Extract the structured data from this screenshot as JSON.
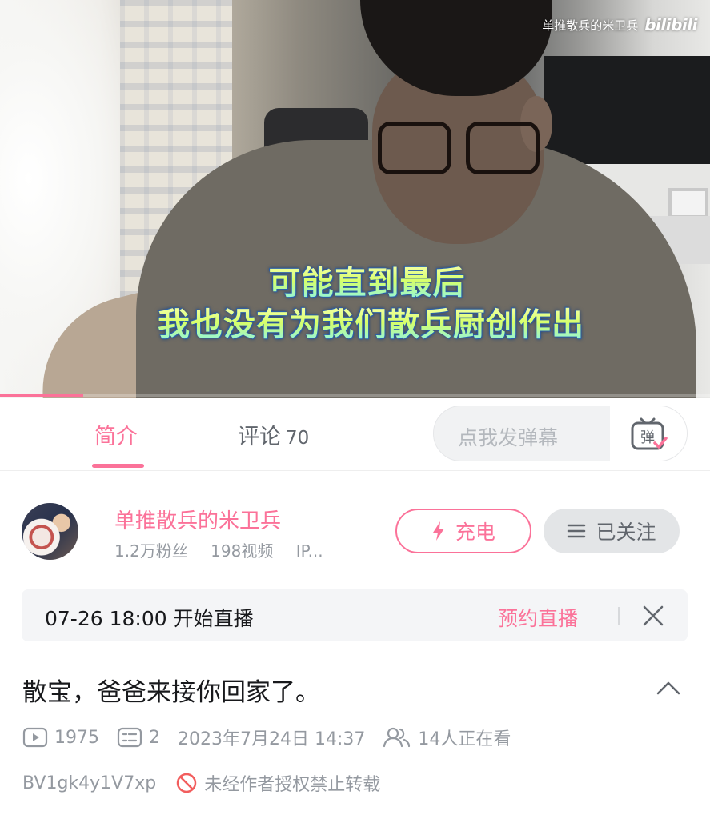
{
  "video": {
    "watermark_author": "单推散兵的米卫兵",
    "watermark_logo": "bilibili",
    "subtitle_line1": "可能直到最后",
    "subtitle_line2": "我也没有为我们散兵厨创作出",
    "progress_fraction": 0.117
  },
  "tabs": [
    {
      "label": "简介",
      "active": true
    },
    {
      "label": "评论",
      "count": "70",
      "active": false
    }
  ],
  "danmaku": {
    "placeholder": "点我发弹幕",
    "button_icon": "danmaku-toggle-icon"
  },
  "uploader": {
    "name": "单推散兵的米卫兵",
    "fans": "1.2万粉丝",
    "videos": "198视频",
    "ip": "IP...",
    "charge_label": "充电",
    "follow_label": "已关注"
  },
  "live_reservation": {
    "time_text": "07-26 18:00 开始直播",
    "book_label": "预约直播"
  },
  "video_info": {
    "title": "散宝，爸爸来接你回家了。",
    "plays": "1975",
    "danmaku_count": "2",
    "pub_time": "2023年7月24日 14:37",
    "watching": "14人正在看",
    "bvid": "BV1gk4y1V7xp",
    "copyright": "未经作者授权禁止转载"
  },
  "colors": {
    "accent": "#fb7299",
    "text_primary": "#18191c",
    "text_secondary": "#9499a0",
    "follow_bg": "#e3e5e7"
  }
}
